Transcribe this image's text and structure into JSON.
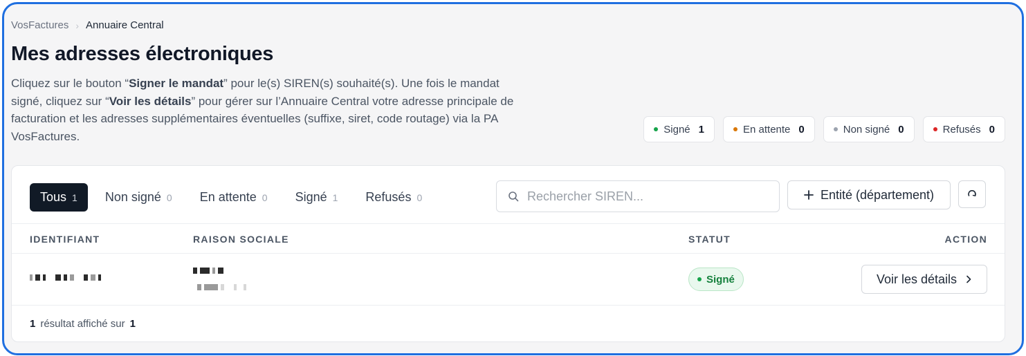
{
  "breadcrumb": {
    "root": "VosFactures",
    "current": "Annuaire Central"
  },
  "page": {
    "title": "Mes adresses électroniques",
    "intro": {
      "p1": "Cliquez sur le bouton “",
      "b1": "Signer le mandat",
      "p2": "” pour le(s) SIREN(s) souhaité(s). Une fois le mandat signé, cliquez sur “",
      "b2": "Voir les détails",
      "p3": "” pour gérer sur l’Annuaire Central votre adresse principale de facturation et les adresses supplémentaires éventuelles (suffixe, siret, code routage) via la PA VosFactures."
    }
  },
  "summary": [
    {
      "label": "Signé",
      "count": "1",
      "color": "#16a34a"
    },
    {
      "label": "En attente",
      "count": "0",
      "color": "#d97706"
    },
    {
      "label": "Non signé",
      "count": "0",
      "color": "#9ca3af"
    },
    {
      "label": "Refusés",
      "count": "0",
      "color": "#dc2626"
    }
  ],
  "tabs": [
    {
      "label": "Tous",
      "count": "1",
      "active": true
    },
    {
      "label": "Non signé",
      "count": "0"
    },
    {
      "label": "En attente",
      "count": "0"
    },
    {
      "label": "Signé",
      "count": "1"
    },
    {
      "label": "Refusés",
      "count": "0"
    }
  ],
  "search": {
    "placeholder": "Rechercher SIREN...",
    "value": ""
  },
  "actions": {
    "add_label": "Entité (département)"
  },
  "table": {
    "columns": {
      "id": "IDENTIFIANT",
      "name": "RAISON SOCIALE",
      "status": "STATUT",
      "action": "ACTION"
    },
    "rows": [
      {
        "status": "Signé",
        "action": "Voir les détails"
      }
    ]
  },
  "footer": {
    "shown": "1",
    "text": "résultat affiché sur",
    "total": "1"
  }
}
